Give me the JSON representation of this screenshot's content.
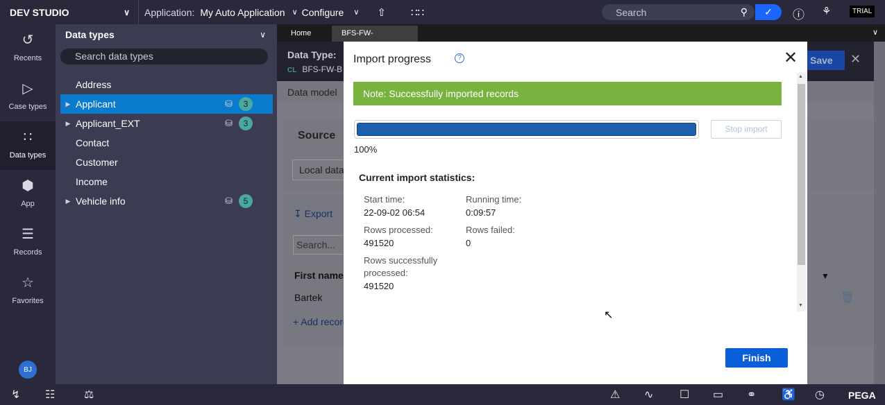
{
  "topbar": {
    "brand": "DEV STUDIO",
    "app_label": "Application:",
    "app_name": "My Auto Application",
    "configure": "Configure",
    "search_placeholder": "Search",
    "trial": "TRIAL"
  },
  "rail": {
    "items": [
      {
        "label": "Recents",
        "icon": "history-icon"
      },
      {
        "label": "Case types",
        "icon": "case-type-icon"
      },
      {
        "label": "Data types",
        "icon": "grid-dots-icon"
      },
      {
        "label": "App",
        "icon": "cube-icon"
      },
      {
        "label": "Records",
        "icon": "layers-icon"
      },
      {
        "label": "Favorites",
        "icon": "star-icon"
      }
    ],
    "avatar": "BJ"
  },
  "explorer": {
    "title": "Data types",
    "search_placeholder": "Search data types",
    "items": [
      {
        "label": "Address",
        "count": ""
      },
      {
        "label": "Applicant",
        "count": "3"
      },
      {
        "label": "Applicant_EXT",
        "count": "3"
      },
      {
        "label": "Contact",
        "count": ""
      },
      {
        "label": "Customer",
        "count": ""
      },
      {
        "label": "Income",
        "count": ""
      },
      {
        "label": "Vehicle info",
        "count": "5"
      }
    ]
  },
  "workarea": {
    "tabs": [
      "Home",
      "BFS-FW-BFSFW-..."
    ],
    "data_type_label": "Data Type:",
    "class_label": "CL",
    "class_name": "BFS-FW-B",
    "save": "Save",
    "sub_tab": "Data model",
    "source_title": "Source",
    "local_data": "Local data",
    "export": "Export",
    "grid_search": "Search...",
    "first_name_header": "First name",
    "row_value": "Bartek",
    "add_record": "+ Add record"
  },
  "modal": {
    "title": "Import progress",
    "note": "Note: Successfully imported  records",
    "progress_value": 1.0,
    "progress_text": "100%",
    "stop_import": "Stop import",
    "stats_heading": "Current import statistics:",
    "start_time_label": "Start time:",
    "start_time": "22-09-02 06:54",
    "running_time_label": "Running time:",
    "running_time": "0:09:57",
    "rows_processed_label": "Rows processed:",
    "rows_processed": "491520",
    "rows_failed_label": "Rows failed:",
    "rows_failed": "0",
    "rows_success_label_1": "Rows successfully",
    "rows_success_label_2": "processed:",
    "rows_success": "491520",
    "finish": "Finish"
  },
  "bottombar": {
    "brand": "PEGA"
  },
  "colors": {
    "accent": "#0a5ed7",
    "success_note": "#77b33e",
    "selected_row": "#0a7acc",
    "count_badge": "#4aa99e"
  }
}
